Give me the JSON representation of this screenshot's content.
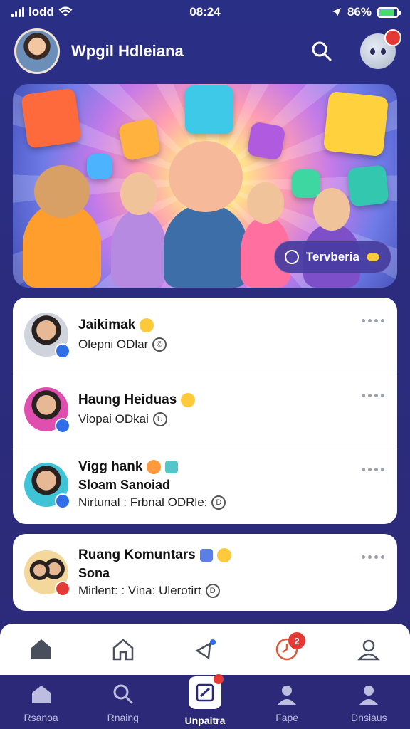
{
  "status_bar": {
    "carrier": "lodd",
    "time": "08:24",
    "battery": "86%",
    "battery_level": 0.86
  },
  "header": {
    "name": "Wpgil Hdleiana"
  },
  "banner": {
    "button_label": "Tervberia"
  },
  "card1": [
    {
      "title": "Jaikimak",
      "subtitle": "Olepni  ODlar",
      "mini_badge": "",
      "mini_color": "#2f6ee8"
    },
    {
      "title": "Haung Heiduas",
      "subtitle": "Viopai  ODkai",
      "mini_badge": "",
      "mini_color": "#2f6ee8"
    },
    {
      "title": "Vigg hank",
      "subtitle2": "Sloam Sanoiad",
      "subtitle": "Nirtunal  : Frbnal  ODRle:",
      "mini_badge": "",
      "mini_color": "#2f6ee8"
    }
  ],
  "card2": {
    "title": "Ruang Komuntars",
    "subtitle2": "Sona",
    "subtitle": "Mirlent:  : Vina:  Ulerotirt",
    "mini_badge": "",
    "mini_color": "#e53935"
  },
  "tabs_top": {
    "notification_count": "2"
  },
  "tabs_bottom": [
    {
      "label": "Rsanoa",
      "icon": "home-icon"
    },
    {
      "label": "Rnaing",
      "icon": "search-icon"
    },
    {
      "label": "Unpaitra",
      "icon": "edit-icon"
    },
    {
      "label": "Fape",
      "icon": "person-icon"
    },
    {
      "label": "Dnsiaus",
      "icon": "person-icon"
    }
  ]
}
